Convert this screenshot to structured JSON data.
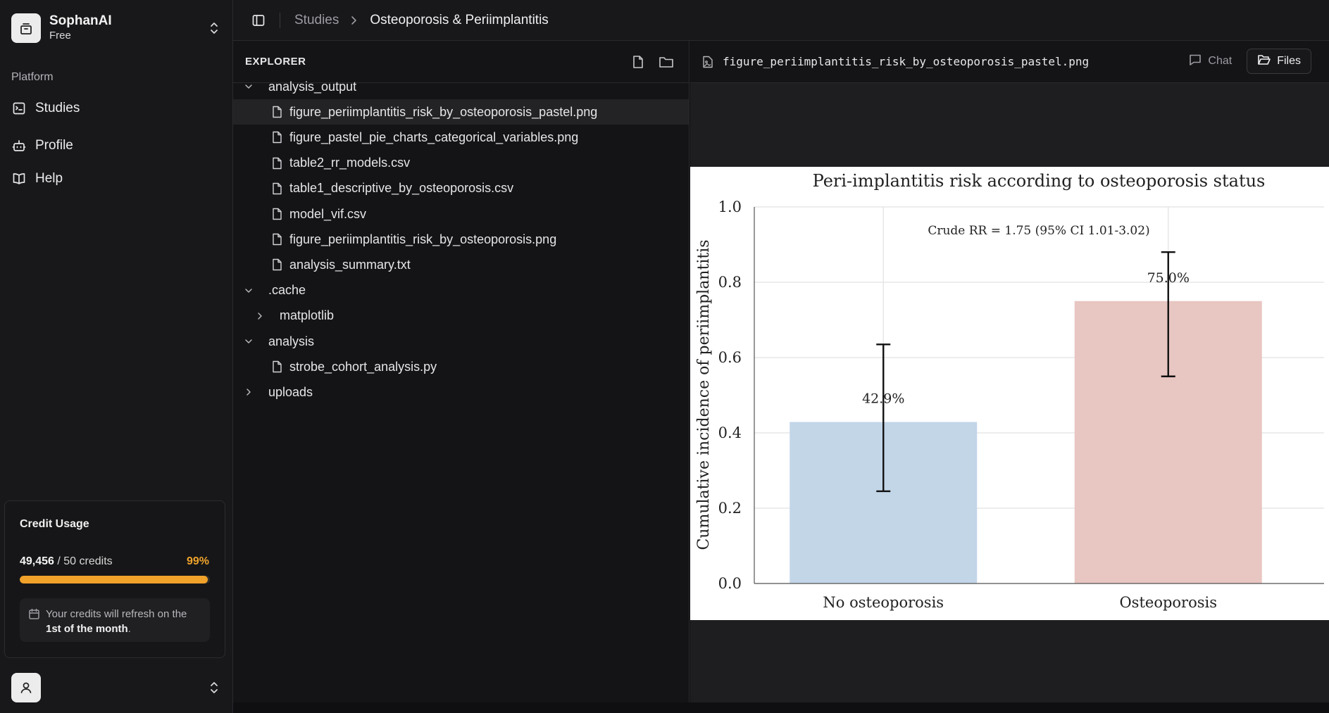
{
  "workspace": {
    "name": "SophanAI",
    "plan": "Free"
  },
  "sidebar": {
    "section_label": "Platform",
    "items": [
      {
        "label": "Studies",
        "icon": "studies-icon"
      },
      {
        "label": "Profile",
        "icon": "bot-icon"
      },
      {
        "label": "Help",
        "icon": "book-icon"
      }
    ]
  },
  "credits": {
    "title": "Credit Usage",
    "used": "49,456",
    "total_text": " / 50 credits",
    "percent_text": "99%",
    "percent_value": 0.99,
    "note_prefix": "Your credits will refresh on the ",
    "note_bold": "1st of the month",
    "note_suffix": ".",
    "bar_color": "#f1a22a"
  },
  "breadcrumb": {
    "parent": "Studies",
    "current": "Osteoporosis & Periimplantitis"
  },
  "explorer": {
    "title": "EXPLORER",
    "tree": [
      {
        "type": "folder",
        "label": "analysis_output",
        "expanded": true,
        "depth": 0
      },
      {
        "type": "file",
        "label": "figure_periimplantitis_risk_by_osteoporosis_pastel.png",
        "depth": 1,
        "selected": true
      },
      {
        "type": "file",
        "label": "figure_pastel_pie_charts_categorical_variables.png",
        "depth": 1
      },
      {
        "type": "file",
        "label": "table2_rr_models.csv",
        "depth": 1
      },
      {
        "type": "file",
        "label": "table1_descriptive_by_osteoporosis.csv",
        "depth": 1
      },
      {
        "type": "file",
        "label": "model_vif.csv",
        "depth": 1
      },
      {
        "type": "file",
        "label": "figure_periimplantitis_risk_by_osteoporosis.png",
        "depth": 1
      },
      {
        "type": "file",
        "label": "analysis_summary.txt",
        "depth": 1
      },
      {
        "type": "folder",
        "label": ".cache",
        "expanded": true,
        "depth": 0
      },
      {
        "type": "folder",
        "label": "matplotlib",
        "expanded": false,
        "depth": 1
      },
      {
        "type": "folder",
        "label": "analysis",
        "expanded": true,
        "depth": 0
      },
      {
        "type": "file",
        "label": "strobe_cohort_analysis.py",
        "depth": 1
      },
      {
        "type": "folder",
        "label": "uploads",
        "expanded": false,
        "depth": 0
      }
    ]
  },
  "preview": {
    "filename": "figure_periimplantitis_risk_by_osteoporosis_pastel.png",
    "tabs": [
      {
        "label": "Chat",
        "active": false,
        "icon": "chat-icon"
      },
      {
        "label": "Files",
        "active": true,
        "icon": "folder-open-icon"
      }
    ]
  },
  "chart_data": {
    "type": "bar",
    "title": "Peri-implantitis risk according to osteoporosis status",
    "xlabel": "",
    "ylabel": "Cumulative incidence of periimplantitis",
    "categories": [
      "No osteoporosis",
      "Osteoporosis"
    ],
    "values": [
      0.429,
      0.75
    ],
    "value_labels": [
      "42.9%",
      "75.0%"
    ],
    "error_low": [
      0.245,
      0.55
    ],
    "error_high": [
      0.635,
      0.88
    ],
    "bar_colors": [
      "#c3d6e8",
      "#e8c6c1"
    ],
    "annotation": "Crude RR = 1.75 (95% CI 1.01-3.02)",
    "ylim": [
      0,
      1.0
    ],
    "yticks": [
      "0.0",
      "0.2",
      "0.4",
      "0.6",
      "0.8",
      "1.0"
    ],
    "grid": true
  }
}
